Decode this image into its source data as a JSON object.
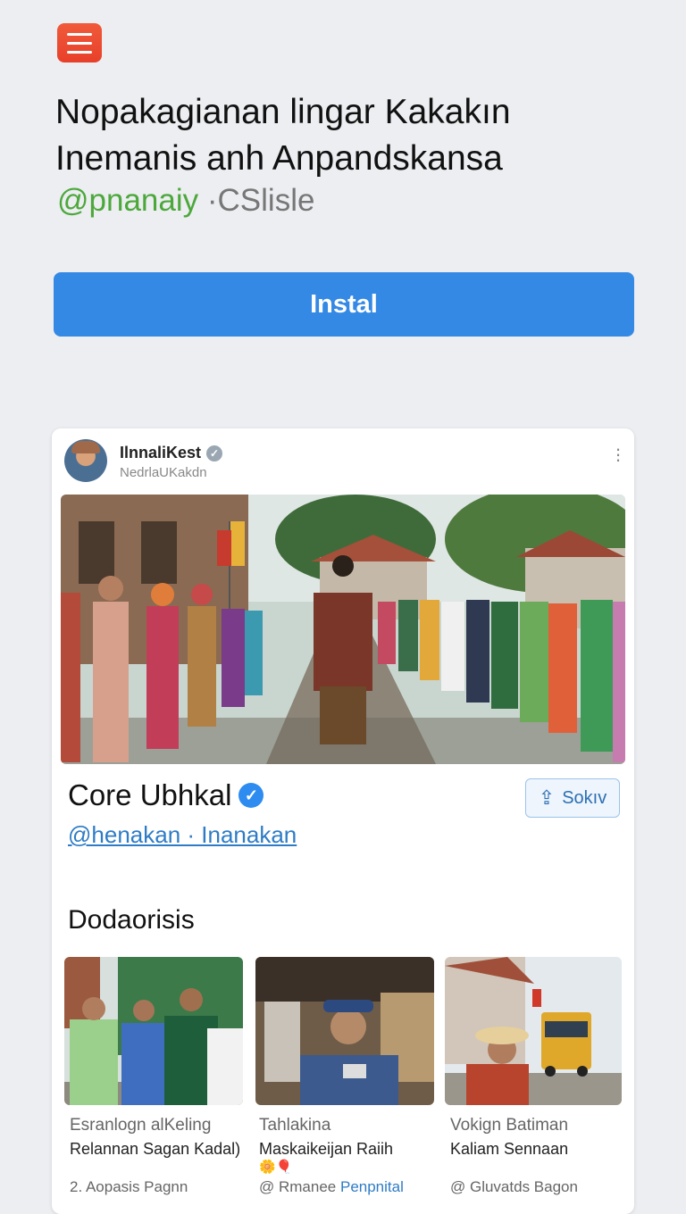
{
  "header": {
    "title_line1": "Nopakagianan lingar Kakakın",
    "title_line2": "Inemanis anh Anpandskansa",
    "handle_green": "@pnanaiy",
    "handle_gray": "·CSlisle"
  },
  "install_label": "Instal",
  "post": {
    "account_name": "IlnnaliKest",
    "account_sub": "NedrlaUKakdn",
    "display_name": "Core Ubhkal",
    "share_label": "Sokıv",
    "handle_link": "@henakan · Inanakan",
    "section_title": "Dodaorisis"
  },
  "thumbnails": [
    {
      "title": "Esranlogn alKeling",
      "subtitle": "Relannan Sagan Kadal)",
      "meta": "2. Aopasis Pagnn"
    },
    {
      "title": "Tahlakina",
      "subtitle": "Maskaikeijan Raiih",
      "emoji": "🌼🎈",
      "meta_prefix": "@ Rmanee",
      "meta_link": "Penpnital"
    },
    {
      "title": "Vokign Batiman",
      "subtitle": "Kaliam Sennaan",
      "meta": "@ Gluvatds Bagon"
    }
  ],
  "colors": {
    "menu_accent": "#ef4d33",
    "install_blue": "#3489e4",
    "handle_green": "#4da83c",
    "link_blue": "#2e7cc6",
    "verified_blue": "#2e8cf0"
  },
  "icons": [
    "menu-icon",
    "verified-icon",
    "more-options-icon",
    "share-icon"
  ]
}
